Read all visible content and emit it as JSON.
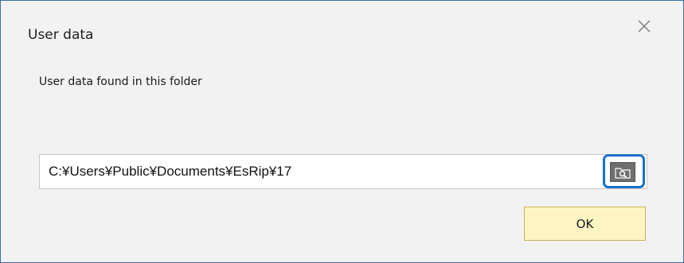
{
  "dialog": {
    "title": "User data",
    "close_icon": "close-icon",
    "message": "User data found in this folder",
    "path": "C:¥Users¥Public¥Documents¥EsRip¥17",
    "browse_icon": "folder-search-icon",
    "ok_label": "OK"
  },
  "colors": {
    "highlight": "#1c6fc8",
    "ok_background": "#fcf5c3",
    "dialog_background": "#f2f2f2"
  }
}
